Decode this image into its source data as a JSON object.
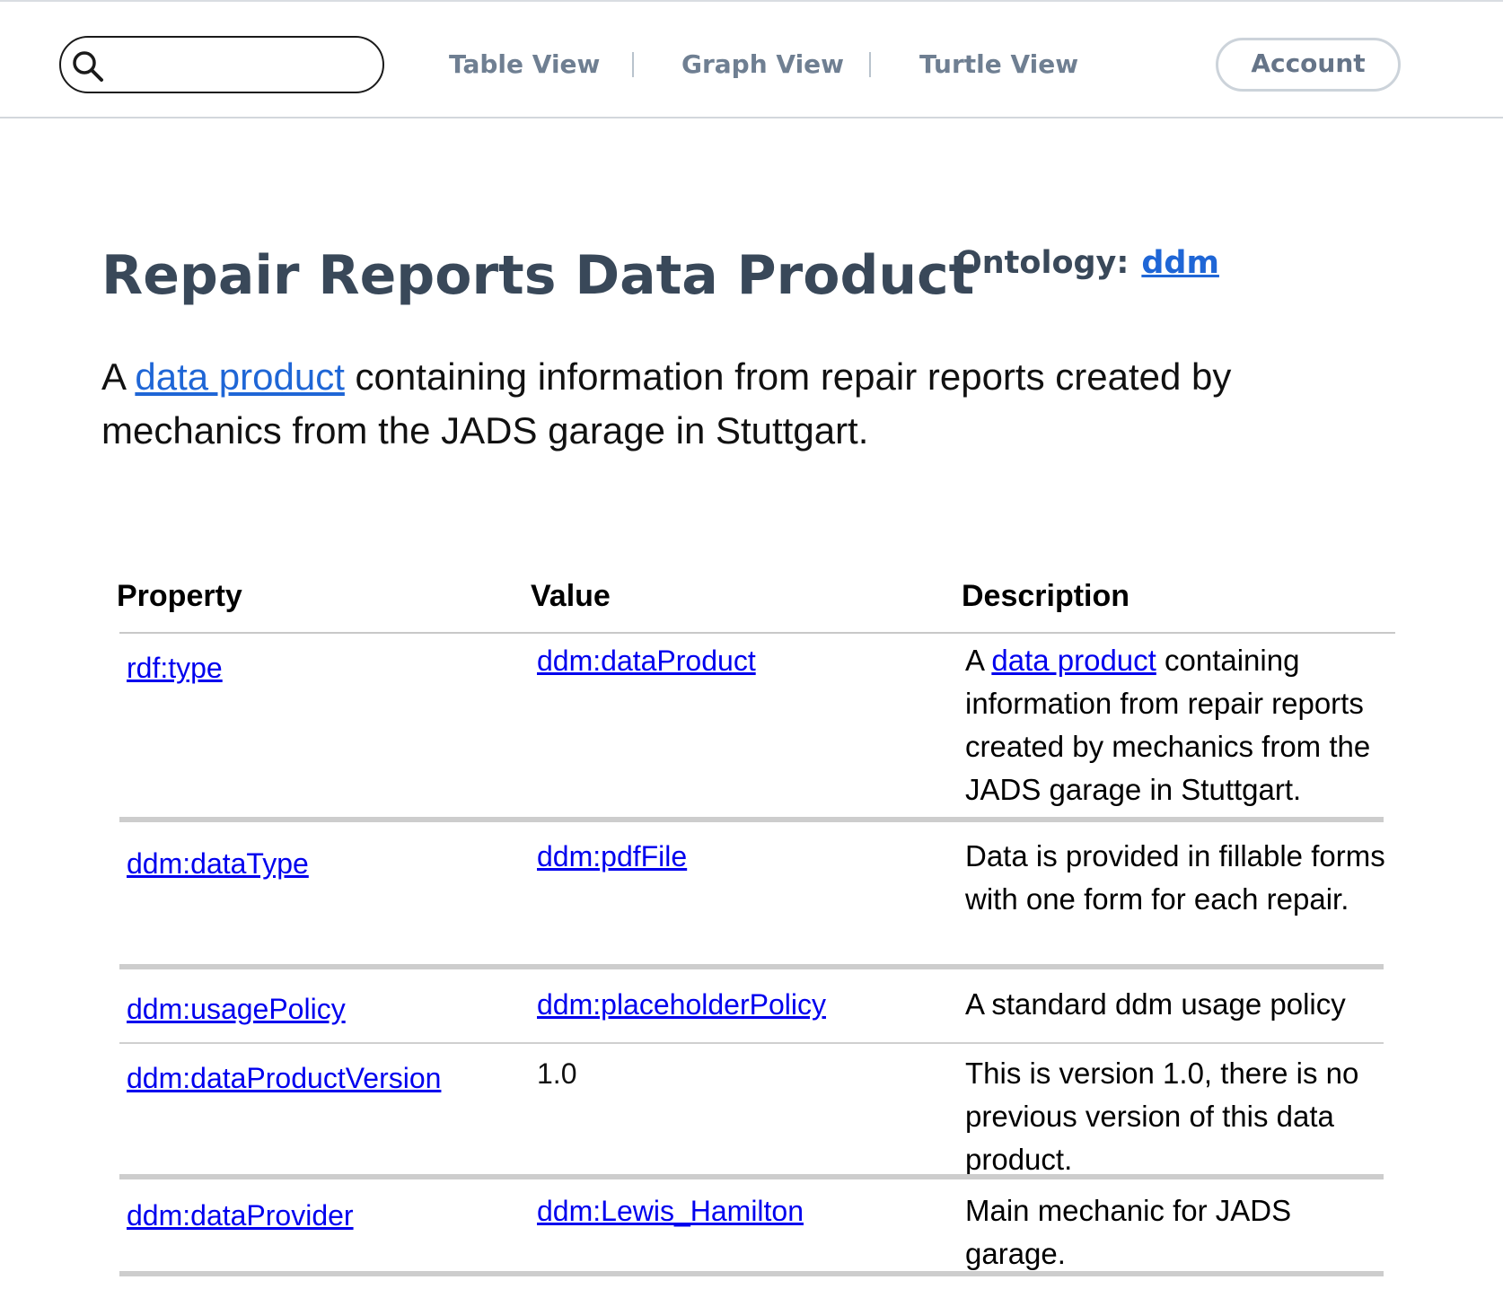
{
  "nav": {
    "search_value": "",
    "links": [
      "Table View",
      "Graph View",
      "Turtle View"
    ],
    "separator": "|",
    "account_label": "Account"
  },
  "header": {
    "title": "Repair Reports Data Product",
    "ontology_label": "Ontology:",
    "ontology_value": "ddm"
  },
  "description": {
    "prefix": "A ",
    "link_text": "data product",
    "suffix": " containing information from repair reports created by mechanics from the JADS garage in Stuttgart."
  },
  "table": {
    "columns": [
      "Property",
      "Value",
      "Description"
    ],
    "rows": [
      {
        "property": "rdf:type",
        "value": "ddm:dataProduct",
        "value_is_link": true,
        "description_prefix": "A ",
        "description_link": "data product",
        "description": " containing information from repair reports created by  mechanics from the JADS garage in Stuttgart."
      },
      {
        "property": "ddm:dataType",
        "value": "ddm:pdfFile",
        "value_is_link": true,
        "description": "Data is provided in fillable forms with one form for each repair."
      },
      {
        "property": "ddm:usagePolicy",
        "value": "ddm:placeholderPolicy",
        "value_is_link": true,
        "description": "A standard ddm usage policy"
      },
      {
        "property": "ddm:dataProductVersion",
        "value": "1.0",
        "value_is_link": false,
        "description": "This is version 1.0, there is no previous version of this data product."
      },
      {
        "property": "ddm:dataProvider",
        "value": "ddm:Lewis_Hamilton",
        "value_is_link": true,
        "description": "Main mechanic for JADS garage."
      }
    ]
  },
  "colors": {
    "link": "#1f66d6",
    "heading": "#394859",
    "nav_text": "#6f7f92"
  }
}
